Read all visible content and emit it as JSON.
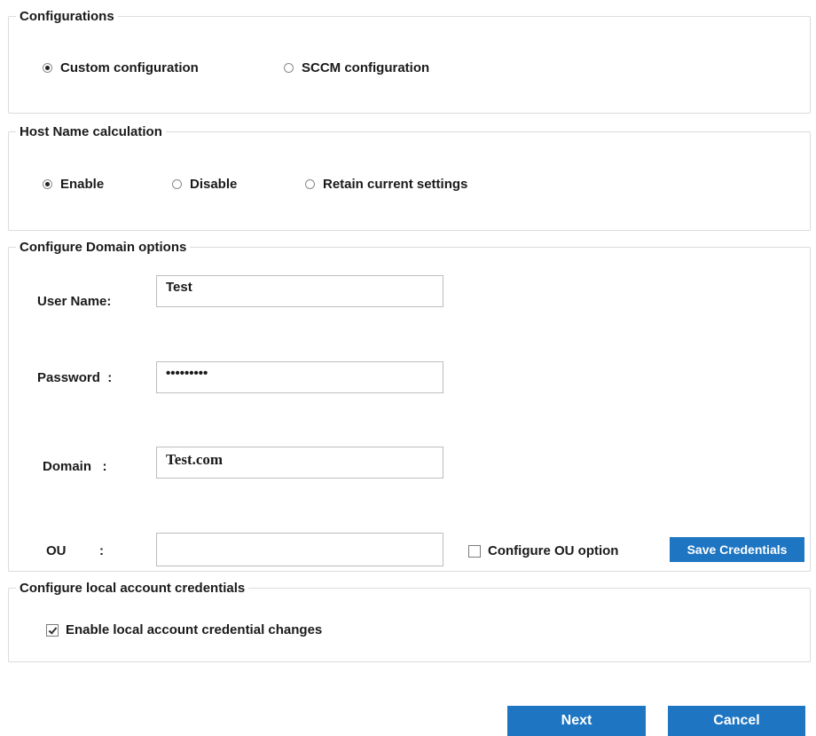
{
  "configurations": {
    "title": "Configurations",
    "options": [
      {
        "label": "Custom configuration",
        "selected": true
      },
      {
        "label": "SCCM configuration",
        "selected": false
      }
    ]
  },
  "hostname": {
    "title": "Host Name calculation",
    "options": [
      {
        "label": "Enable",
        "selected": true
      },
      {
        "label": "Disable",
        "selected": false
      },
      {
        "label": "Retain current settings",
        "selected": false
      }
    ]
  },
  "domain_options": {
    "title": "Configure Domain options",
    "username": {
      "label": "User Name:",
      "value": "Test"
    },
    "password": {
      "label": "Password  :",
      "value": "•••••••••"
    },
    "domain": {
      "label": "Domain   :",
      "value": "Test.com"
    },
    "ou": {
      "label": "OU         :",
      "value": ""
    },
    "configure_ou": {
      "label": "Configure OU option",
      "checked": false
    },
    "save_credentials": "Save Credentials"
  },
  "local_account": {
    "title": "Configure local account credentials",
    "enable_changes": {
      "label": "Enable local account credential changes",
      "checked": true
    }
  },
  "footer": {
    "next": "Next",
    "cancel": "Cancel"
  },
  "colors": {
    "button_bg": "#1e75c2",
    "button_text": "#ffffff",
    "border": "#dcdcdc"
  }
}
